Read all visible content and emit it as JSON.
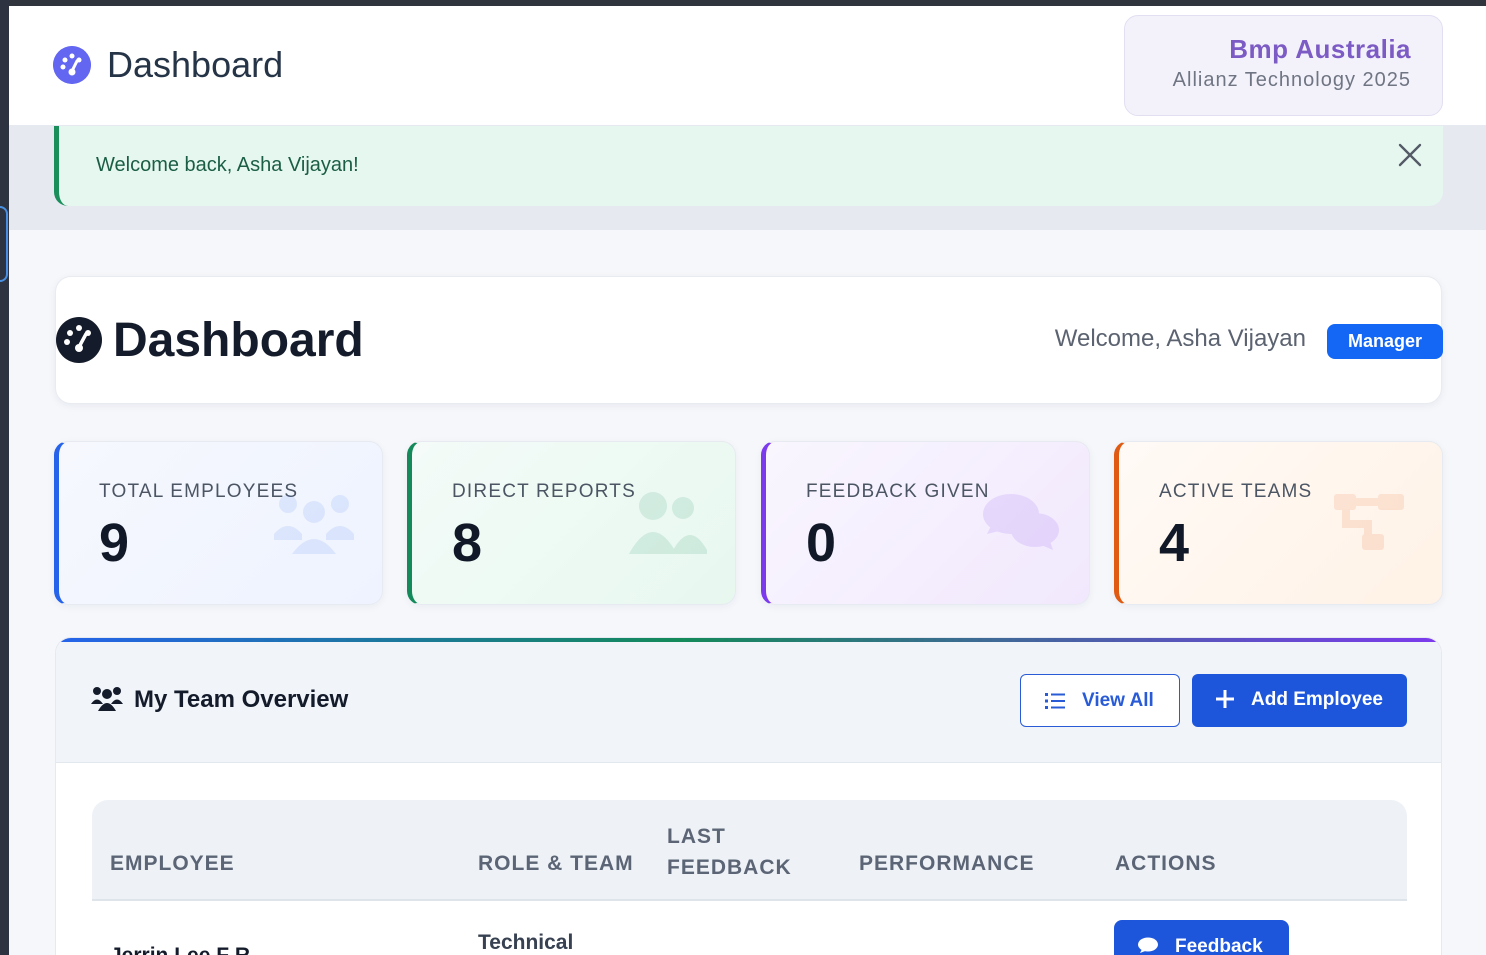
{
  "header": {
    "title": "Dashboard",
    "brand_name": "Bmp Australia",
    "brand_sub": "Allianz Technology 2025"
  },
  "alert": {
    "message": "Welcome back, Asha Vijayan!"
  },
  "dashboard": {
    "title": "Dashboard",
    "welcome": "Welcome, Asha Vijayan",
    "role_badge": "Manager"
  },
  "stats": [
    {
      "label": "TOTAL EMPLOYEES",
      "value": "9",
      "icon": "users-icon",
      "accent": "#2563eb"
    },
    {
      "label": "DIRECT REPORTS",
      "value": "8",
      "icon": "user-friends-icon",
      "accent": "#148a5a"
    },
    {
      "label": "FEEDBACK GIVEN",
      "value": "0",
      "icon": "comments-icon",
      "accent": "#7c3aed"
    },
    {
      "label": "ACTIVE TEAMS",
      "value": "4",
      "icon": "sitemap-icon",
      "accent": "#e05a12"
    }
  ],
  "team": {
    "title": "My Team Overview",
    "view_all": "View All",
    "add_employee": "Add Employee",
    "columns": [
      "EMPLOYEE",
      "ROLE & TEAM",
      "LAST FEEDBACK",
      "PERFORMANCE",
      "ACTIONS"
    ],
    "rows": [
      {
        "employee": "Jerrin Lee F R",
        "role": "Technical",
        "action": "Feedback"
      }
    ]
  }
}
